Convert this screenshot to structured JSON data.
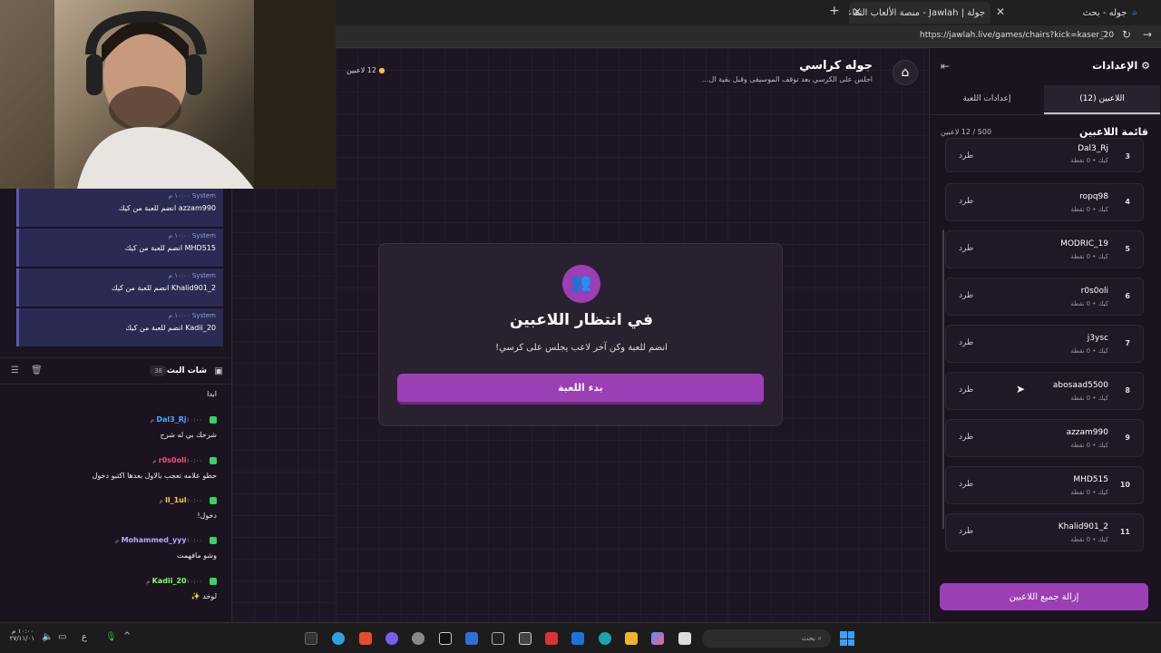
{
  "browser": {
    "tabs": [
      {
        "label": "جوله - بحث"
      },
      {
        "label": "جولة | Jawlah - منصة الألعاب التفاعلية"
      }
    ],
    "url": "https://jawlah.live/games/chairs?kick=kaser_20"
  },
  "game": {
    "title": "جوله كراسي",
    "description": "اجلس على الكرسي بعد توقف الموسيقى وقبل بقية ال...",
    "player_count": "12 لاعبين",
    "waiting_title": "في انتظار اللاعبين",
    "waiting_subtitle": "انضم للعبة وكن آخر لاعب يجلس على كرسي!",
    "start_button": "بدء اللعبة"
  },
  "settings": {
    "title": "الإعدادات",
    "tabs": [
      {
        "label": "اللاعبين (12)"
      },
      {
        "label": "إعدادات اللعبة"
      }
    ],
    "list_title": "قائمة اللاعبين",
    "capacity": "500 / 12 لاعبين",
    "remove_all": "إزالة جميع اللاعبين",
    "players": [
      {
        "num": "3",
        "name": "Dal3_Rj",
        "sub": "كيك • 0 نقطة",
        "kick": "طرد"
      },
      {
        "num": "4",
        "name": "ropq98",
        "sub": "كيك • 0 نقطة",
        "kick": "طرد"
      },
      {
        "num": "5",
        "name": "MODRIC_19",
        "sub": "كيك • 0 نقطة",
        "kick": "طرد"
      },
      {
        "num": "6",
        "name": "r0s0oli",
        "sub": "كيك • 0 نقطة",
        "kick": "طرد"
      },
      {
        "num": "7",
        "name": "j3ysc",
        "sub": "كيك • 0 نقطة",
        "kick": "طرد"
      },
      {
        "num": "8",
        "name": "abosaad5500",
        "sub": "كيك • 0 نقطة",
        "kick": "طرد"
      },
      {
        "num": "9",
        "name": "azzam990",
        "sub": "كيك • 0 نقطة",
        "kick": "طرد"
      },
      {
        "num": "10",
        "name": "MHD515",
        "sub": "كيك • 0 نقطة",
        "kick": "طرد"
      },
      {
        "num": "11",
        "name": "Khalid901_2",
        "sub": "كيك • 0 نقطة",
        "kick": "طرد"
      }
    ]
  },
  "system_messages": [
    {
      "sender": "System",
      "time": "١٠:٠٠ م",
      "text": "azzam990 انضم للعبة من كيك"
    },
    {
      "sender": "System",
      "time": "١٠:٠٠ م",
      "text": "MHD515 انضم للعبة من كيك"
    },
    {
      "sender": "System",
      "time": "١٠:٠٠ م",
      "text": "Khalid901_2 انضم للعبة من كيك"
    },
    {
      "sender": "System",
      "time": "١٠:٠٠ م",
      "text": "Kadii_20 انضم للعبة من كيك"
    }
  ],
  "chat": {
    "title": "شات البث",
    "count": "38",
    "first_text": "ابدا",
    "messages": [
      {
        "user": "Dal3_Rj",
        "color": "#4aa8ff",
        "time": "١٠:٠٠ م",
        "text": "شرحك بي له شرح"
      },
      {
        "user": "r0s0oli",
        "color": "#ff4d6d",
        "time": "١٠:٠٠ م",
        "text": "حطو علامه تعجب بالاول بعدها اكتبو دخول"
      },
      {
        "user": "ll_1ul",
        "color": "#ffd23f",
        "time": "١٠:٠٠ م",
        "text": "دخول!"
      },
      {
        "user": "Mohammed_yyy",
        "color": "#b9a7ff",
        "time": "١٠:٠٠ م",
        "text": "وشو مافهمت"
      },
      {
        "user": "Kadii_20",
        "color": "#7dff6a",
        "time": "١٠:٠٠ م",
        "text": "لوخد ✨"
      }
    ]
  },
  "taskbar": {
    "search_placeholder": "بحث",
    "clock_time": "١٠:٠٠ م",
    "clock_date": "٢٧/١١/٠١",
    "lang": "ع"
  },
  "colors": {
    "accent": "#9b3fb5",
    "bg": "#1d1424",
    "panel": "#1a1320"
  }
}
